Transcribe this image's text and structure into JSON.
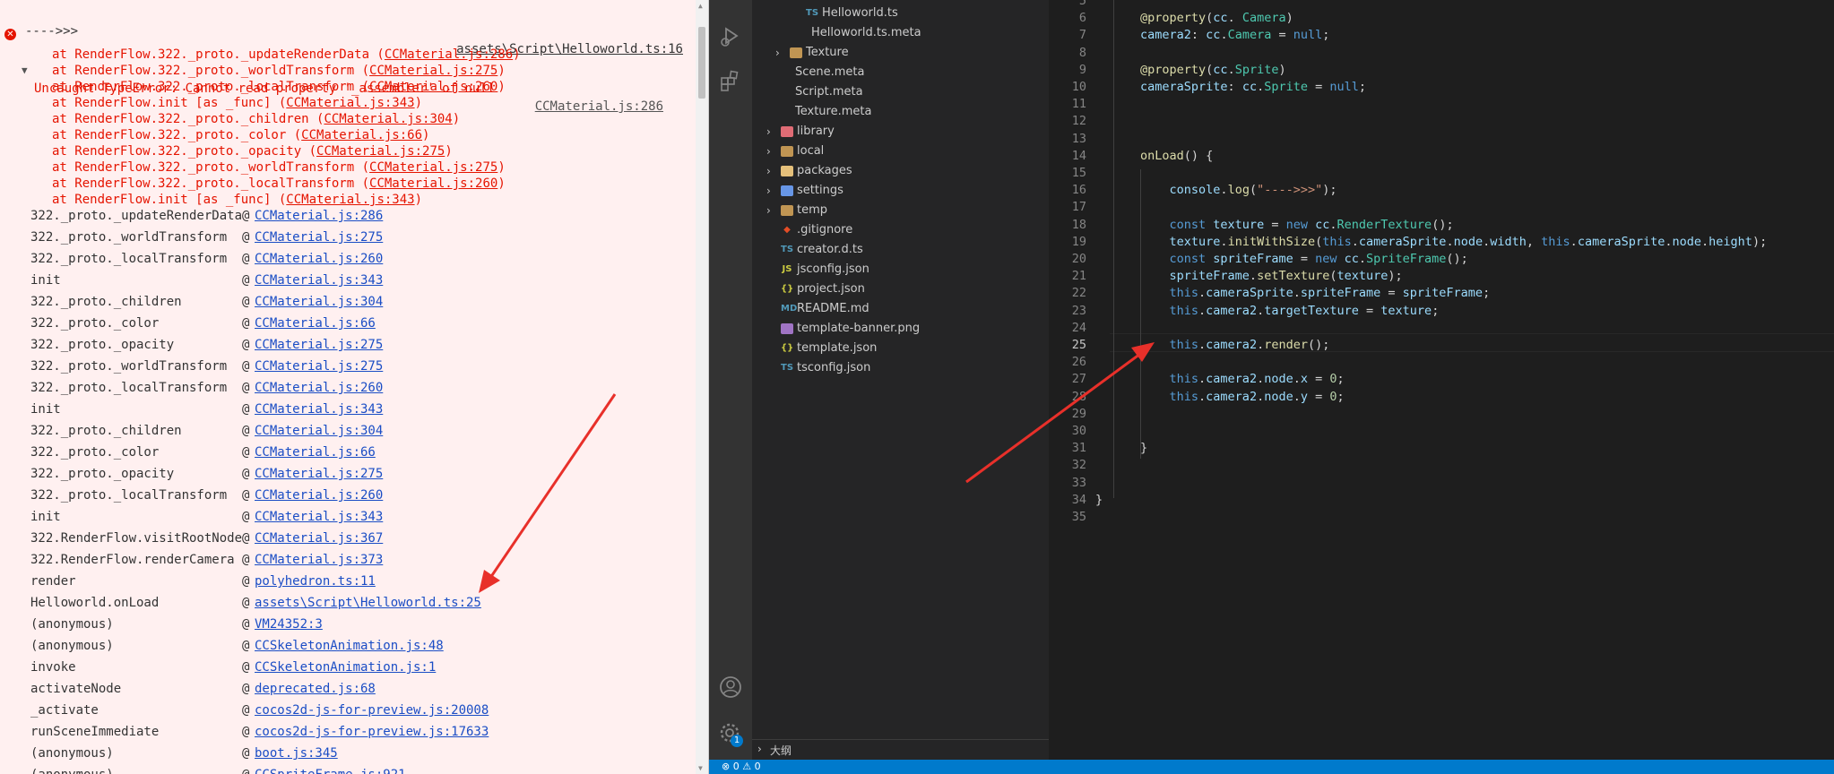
{
  "console": {
    "top_log": {
      "text": "---->>>",
      "source": "assets\\Script\\Helloworld.ts:16"
    },
    "error": {
      "message": "Uncaught TypeError: Cannot read property '_assembler' of null",
      "source": "CCMaterial.js:286",
      "at_lines": [
        {
          "text": "at RenderFlow.322._proto._updateRenderData (",
          "link": "CCMaterial.js:286",
          "tail": ")"
        },
        {
          "text": "at RenderFlow.322._proto._worldTransform (",
          "link": "CCMaterial.js:275",
          "tail": ")"
        },
        {
          "text": "at RenderFlow.322._proto._localTransform (",
          "link": "CCMaterial.js:260",
          "tail": ")"
        },
        {
          "text": "at RenderFlow.init [as _func] (",
          "link": "CCMaterial.js:343",
          "tail": ")"
        },
        {
          "text": "at RenderFlow.322._proto._children (",
          "link": "CCMaterial.js:304",
          "tail": ")"
        },
        {
          "text": "at RenderFlow.322._proto._color (",
          "link": "CCMaterial.js:66",
          "tail": ")"
        },
        {
          "text": "at RenderFlow.322._proto._opacity (",
          "link": "CCMaterial.js:275",
          "tail": ")"
        },
        {
          "text": "at RenderFlow.322._proto._worldTransform (",
          "link": "CCMaterial.js:275",
          "tail": ")"
        },
        {
          "text": "at RenderFlow.322._proto._localTransform (",
          "link": "CCMaterial.js:260",
          "tail": ")"
        },
        {
          "text": "at RenderFlow.init [as _func] (",
          "link": "CCMaterial.js:343",
          "tail": ")"
        }
      ]
    },
    "stack": [
      {
        "fn": "322._proto._updateRenderData",
        "link": "CCMaterial.js:286"
      },
      {
        "fn": "322._proto._worldTransform",
        "link": "CCMaterial.js:275"
      },
      {
        "fn": "322._proto._localTransform",
        "link": "CCMaterial.js:260"
      },
      {
        "fn": "init",
        "link": "CCMaterial.js:343"
      },
      {
        "fn": "322._proto._children",
        "link": "CCMaterial.js:304"
      },
      {
        "fn": "322._proto._color",
        "link": "CCMaterial.js:66"
      },
      {
        "fn": "322._proto._opacity",
        "link": "CCMaterial.js:275"
      },
      {
        "fn": "322._proto._worldTransform",
        "link": "CCMaterial.js:275"
      },
      {
        "fn": "322._proto._localTransform",
        "link": "CCMaterial.js:260"
      },
      {
        "fn": "init",
        "link": "CCMaterial.js:343"
      },
      {
        "fn": "322._proto._children",
        "link": "CCMaterial.js:304"
      },
      {
        "fn": "322._proto._color",
        "link": "CCMaterial.js:66"
      },
      {
        "fn": "322._proto._opacity",
        "link": "CCMaterial.js:275"
      },
      {
        "fn": "322._proto._localTransform",
        "link": "CCMaterial.js:260"
      },
      {
        "fn": "init",
        "link": "CCMaterial.js:343"
      },
      {
        "fn": "322.RenderFlow.visitRootNode",
        "link": "CCMaterial.js:367"
      },
      {
        "fn": "322.RenderFlow.renderCamera",
        "link": "CCMaterial.js:373"
      },
      {
        "fn": "render",
        "link": "polyhedron.ts:11"
      },
      {
        "fn": "Helloworld.onLoad",
        "link": "assets\\Script\\Helloworld.ts:25"
      },
      {
        "fn": "(anonymous)",
        "link": "VM24352:3"
      },
      {
        "fn": "(anonymous)",
        "link": "CCSkeletonAnimation.js:48"
      },
      {
        "fn": "invoke",
        "link": "CCSkeletonAnimation.js:1"
      },
      {
        "fn": "activateNode",
        "link": "deprecated.js:68"
      },
      {
        "fn": "_activate",
        "link": "cocos2d-js-for-preview.js:20008"
      },
      {
        "fn": "runSceneImmediate",
        "link": "cocos2d-js-for-preview.js:17633"
      },
      {
        "fn": "(anonymous)",
        "link": "boot.js:345"
      },
      {
        "fn": "(anonymous)",
        "link": "CCSpriteFrame.js:921"
      }
    ],
    "at_symbol": "@"
  },
  "explorer": {
    "items": [
      {
        "label": "Helloworld.ts",
        "icon": "TS",
        "icon_color": "#519aba",
        "chevron": ""
      },
      {
        "label": "Helloworld.ts.meta",
        "icon": "",
        "icon_color": "#8fa4b8",
        "chevron": ""
      },
      {
        "label": "Texture",
        "icon": "folder",
        "icon_color": "#c09553",
        "chevron": "›"
      },
      {
        "label": "Scene.meta",
        "icon": "",
        "icon_color": "#8fa4b8",
        "chevron": ""
      },
      {
        "label": "Script.meta",
        "icon": "",
        "icon_color": "#8fa4b8",
        "chevron": ""
      },
      {
        "label": "Texture.meta",
        "icon": "",
        "icon_color": "#8fa4b8",
        "chevron": ""
      },
      {
        "label": "library",
        "icon": "folder",
        "icon_color": "#e06c75",
        "chevron": "›"
      },
      {
        "label": "local",
        "icon": "folder",
        "icon_color": "#c09553",
        "chevron": "›"
      },
      {
        "label": "packages",
        "icon": "folder",
        "icon_color": "#e5c07b",
        "chevron": "›"
      },
      {
        "label": "settings",
        "icon": "folder",
        "icon_color": "#6796e6",
        "chevron": "›"
      },
      {
        "label": "temp",
        "icon": "folder",
        "icon_color": "#c09553",
        "chevron": "›"
      },
      {
        "label": ".gitignore",
        "icon": "◆",
        "icon_color": "#e44d26",
        "chevron": ""
      },
      {
        "label": "creator.d.ts",
        "icon": "TS",
        "icon_color": "#519aba",
        "chevron": ""
      },
      {
        "label": "jsconfig.json",
        "icon": "JS",
        "icon_color": "#cbcb41",
        "chevron": ""
      },
      {
        "label": "project.json",
        "icon": "{}",
        "icon_color": "#cbcb41",
        "chevron": ""
      },
      {
        "label": "README.md",
        "icon": "MD",
        "icon_color": "#519aba",
        "chevron": ""
      },
      {
        "label": "template-banner.png",
        "icon": "img",
        "icon_color": "#a074c4",
        "chevron": ""
      },
      {
        "label": "template.json",
        "icon": "{}",
        "icon_color": "#cbcb41",
        "chevron": ""
      },
      {
        "label": "tsconfig.json",
        "icon": "TS",
        "icon_color": "#519aba",
        "chevron": ""
      }
    ],
    "outline_label": "大纲",
    "settings_badge": "1"
  },
  "editor": {
    "active_line": 25,
    "lines": [
      {
        "n": 5,
        "tokens": []
      },
      {
        "n": 6,
        "tokens": [
          [
            "dec",
            "@property"
          ],
          [
            "",
            "("
          ],
          [
            "vr",
            "cc"
          ],
          [
            "",
            ". "
          ],
          [
            "ty",
            "Camera"
          ],
          [
            "",
            ")"
          ]
        ]
      },
      {
        "n": 7,
        "tokens": [
          [
            "vr",
            "camera2"
          ],
          [
            "",
            ": "
          ],
          [
            "vr",
            "cc"
          ],
          [
            "",
            "."
          ],
          [
            "ty",
            "Camera"
          ],
          [
            "",
            " = "
          ],
          [
            "kw",
            "null"
          ],
          [
            "",
            ";"
          ]
        ]
      },
      {
        "n": 8,
        "tokens": []
      },
      {
        "n": 9,
        "tokens": [
          [
            "dec",
            "@property"
          ],
          [
            "",
            "("
          ],
          [
            "vr",
            "cc"
          ],
          [
            "",
            "."
          ],
          [
            "ty",
            "Sprite"
          ],
          [
            "",
            ")"
          ]
        ]
      },
      {
        "n": 10,
        "tokens": [
          [
            "vr",
            "cameraSprite"
          ],
          [
            "",
            ": "
          ],
          [
            "vr",
            "cc"
          ],
          [
            "",
            "."
          ],
          [
            "ty",
            "Sprite"
          ],
          [
            "",
            " = "
          ],
          [
            "kw",
            "null"
          ],
          [
            "",
            ";"
          ]
        ]
      },
      {
        "n": 11,
        "tokens": []
      },
      {
        "n": 12,
        "tokens": []
      },
      {
        "n": 13,
        "tokens": []
      },
      {
        "n": 14,
        "tokens": [
          [
            "fnc",
            "onLoad"
          ],
          [
            "",
            "() {"
          ]
        ]
      },
      {
        "n": 15,
        "tokens": []
      },
      {
        "n": 16,
        "tokens": [
          [
            "",
            "    "
          ],
          [
            "vr",
            "console"
          ],
          [
            "",
            "."
          ],
          [
            "fnc",
            "log"
          ],
          [
            "",
            "("
          ],
          [
            "st",
            "\"---->>>\""
          ],
          [
            "",
            ");"
          ]
        ]
      },
      {
        "n": 17,
        "tokens": []
      },
      {
        "n": 18,
        "tokens": [
          [
            "",
            "    "
          ],
          [
            "kw",
            "const "
          ],
          [
            "vr",
            "texture"
          ],
          [
            "",
            " = "
          ],
          [
            "kw",
            "new "
          ],
          [
            "vr",
            "cc"
          ],
          [
            "",
            "."
          ],
          [
            "ty",
            "RenderTexture"
          ],
          [
            "",
            "();"
          ]
        ]
      },
      {
        "n": 19,
        "tokens": [
          [
            "",
            "    "
          ],
          [
            "vr",
            "texture"
          ],
          [
            "",
            "."
          ],
          [
            "fnc",
            "initWithSize"
          ],
          [
            "",
            "("
          ],
          [
            "kw",
            "this"
          ],
          [
            "",
            "."
          ],
          [
            "vr",
            "cameraSprite"
          ],
          [
            "",
            "."
          ],
          [
            "vr",
            "node"
          ],
          [
            "",
            "."
          ],
          [
            "vr",
            "width"
          ],
          [
            "",
            ", "
          ],
          [
            "kw",
            "this"
          ],
          [
            "",
            "."
          ],
          [
            "vr",
            "cameraSprite"
          ],
          [
            "",
            "."
          ],
          [
            "vr",
            "node"
          ],
          [
            "",
            "."
          ],
          [
            "vr",
            "height"
          ],
          [
            "",
            ");"
          ]
        ]
      },
      {
        "n": 20,
        "tokens": [
          [
            "",
            "    "
          ],
          [
            "kw",
            "const "
          ],
          [
            "vr",
            "spriteFrame"
          ],
          [
            "",
            " = "
          ],
          [
            "kw",
            "new "
          ],
          [
            "vr",
            "cc"
          ],
          [
            "",
            "."
          ],
          [
            "ty",
            "SpriteFrame"
          ],
          [
            "",
            "();"
          ]
        ]
      },
      {
        "n": 21,
        "tokens": [
          [
            "",
            "    "
          ],
          [
            "vr",
            "spriteFrame"
          ],
          [
            "",
            "."
          ],
          [
            "fnc",
            "setTexture"
          ],
          [
            "",
            "("
          ],
          [
            "vr",
            "texture"
          ],
          [
            "",
            ");"
          ]
        ]
      },
      {
        "n": 22,
        "tokens": [
          [
            "",
            "    "
          ],
          [
            "kw",
            "this"
          ],
          [
            "",
            "."
          ],
          [
            "vr",
            "cameraSprite"
          ],
          [
            "",
            "."
          ],
          [
            "vr",
            "spriteFrame"
          ],
          [
            "",
            " = "
          ],
          [
            "vr",
            "spriteFrame"
          ],
          [
            "",
            ";"
          ]
        ]
      },
      {
        "n": 23,
        "tokens": [
          [
            "",
            "    "
          ],
          [
            "kw",
            "this"
          ],
          [
            "",
            "."
          ],
          [
            "vr",
            "camera2"
          ],
          [
            "",
            "."
          ],
          [
            "vr",
            "targetTexture"
          ],
          [
            "",
            " = "
          ],
          [
            "vr",
            "texture"
          ],
          [
            "",
            ";"
          ]
        ]
      },
      {
        "n": 24,
        "tokens": []
      },
      {
        "n": 25,
        "tokens": [
          [
            "",
            "    "
          ],
          [
            "kw",
            "this"
          ],
          [
            "",
            "."
          ],
          [
            "vr",
            "camera2"
          ],
          [
            "",
            "."
          ],
          [
            "fnc",
            "render"
          ],
          [
            "",
            "();"
          ]
        ]
      },
      {
        "n": 26,
        "tokens": []
      },
      {
        "n": 27,
        "tokens": [
          [
            "",
            "    "
          ],
          [
            "kw",
            "this"
          ],
          [
            "",
            "."
          ],
          [
            "vr",
            "camera2"
          ],
          [
            "",
            "."
          ],
          [
            "vr",
            "node"
          ],
          [
            "",
            "."
          ],
          [
            "vr",
            "x"
          ],
          [
            "",
            " = "
          ],
          [
            "nm",
            "0"
          ],
          [
            "",
            ";"
          ]
        ]
      },
      {
        "n": 28,
        "tokens": [
          [
            "",
            "    "
          ],
          [
            "kw",
            "this"
          ],
          [
            "",
            "."
          ],
          [
            "vr",
            "camera2"
          ],
          [
            "",
            "."
          ],
          [
            "vr",
            "node"
          ],
          [
            "",
            "."
          ],
          [
            "vr",
            "y"
          ],
          [
            "",
            " = "
          ],
          [
            "nm",
            "0"
          ],
          [
            "",
            ";"
          ]
        ]
      },
      {
        "n": 29,
        "tokens": []
      },
      {
        "n": 30,
        "tokens": []
      },
      {
        "n": 31,
        "tokens": [
          [
            "",
            "}"
          ]
        ]
      },
      {
        "n": 32,
        "tokens": []
      },
      {
        "n": 33,
        "tokens": []
      },
      {
        "n": 34,
        "tokens": [
          [
            "back",
            "}"
          ]
        ]
      },
      {
        "n": 35,
        "tokens": []
      }
    ]
  },
  "statusbar": {
    "errors": "0",
    "warnings": "0"
  },
  "colors": {
    "error_red": "#e51400",
    "link_blue": "#1a4dc5",
    "status_blue": "#007acc",
    "arrow_red": "#e8302a"
  }
}
